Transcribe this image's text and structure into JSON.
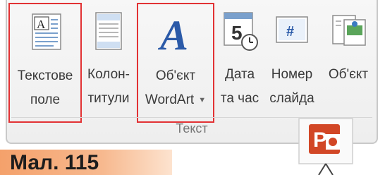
{
  "ribbon": {
    "group_label": "Текст",
    "buttons": [
      {
        "line1": "Текстове",
        "line2": "поле",
        "icon": "text-box-icon"
      },
      {
        "line1": "Колон-",
        "line2": "титули",
        "icon": "header-footer-icon"
      },
      {
        "line1": "Об'єкт",
        "line2": "WordArt",
        "icon": "wordart-icon"
      },
      {
        "line1": "Дата",
        "line2": "та час",
        "icon": "date-time-icon"
      },
      {
        "line1": "Номер",
        "line2": "слайда",
        "icon": "slide-number-icon"
      },
      {
        "line1": "Об'єкт",
        "line2": "",
        "icon": "insert-object-icon"
      }
    ]
  },
  "caption": "Мал. 115",
  "colors": {
    "highlight": "#e23234",
    "wordart_blue": "#2b5aa8",
    "caption_bg": "#f4a16b"
  }
}
